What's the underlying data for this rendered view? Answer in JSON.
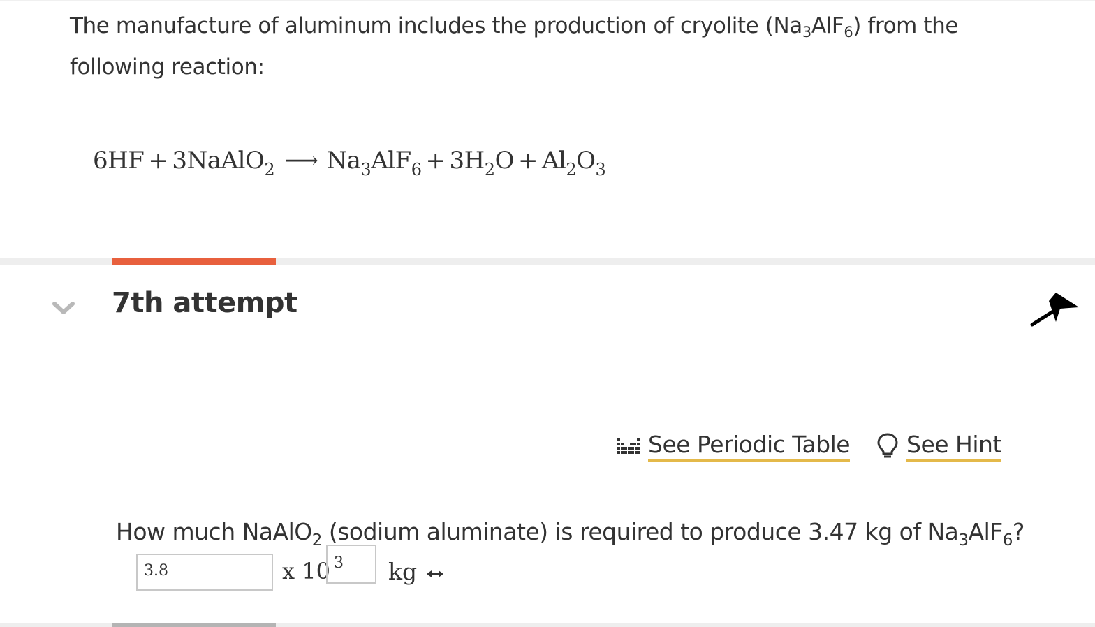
{
  "problem": {
    "intro_before_formula": "The manufacture of aluminum includes the production of cryolite (Na",
    "intro_sub_3": "3",
    "intro_mid": "AlF",
    "intro_sub_6": "6",
    "intro_after_formula": ") from the following reaction:"
  },
  "equation": {
    "reactant_1": "6HF",
    "plus_1": "+",
    "reactant_2_text": "3NaAlO",
    "reactant_2_sub": "2",
    "arrow": "⟶",
    "product_1_na": "Na",
    "product_1_na_sub": "3",
    "product_1_alf": "AlF",
    "product_1_f_sub": "6",
    "plus_2": "+",
    "product_2_text": "3H",
    "product_2_sub": "2",
    "product_2_o": "O",
    "plus_3": "+",
    "product_3_al": "Al",
    "product_3_al_sub": "2",
    "product_3_o": "O",
    "product_3_o_sub": "3"
  },
  "attempt": {
    "title": "7th attempt"
  },
  "tools": {
    "periodic_table_label": "See Periodic Table",
    "hint_label": "See Hint"
  },
  "question": {
    "part_1": "How much NaAlO",
    "sub_1": "2",
    "part_2": " (sodium aluminate) is required to produce 3.47 kg of Na",
    "sub_2": "3",
    "part_3": "AlF",
    "sub_3": "6",
    "part_4": "?"
  },
  "answer": {
    "coefficient_value": "3.8",
    "times_ten": "x 10",
    "exponent_value": "3",
    "unit": "kg"
  },
  "colors": {
    "accent_tab": "#e8603d",
    "link_underline": "#e4b94a",
    "text": "#333333"
  }
}
